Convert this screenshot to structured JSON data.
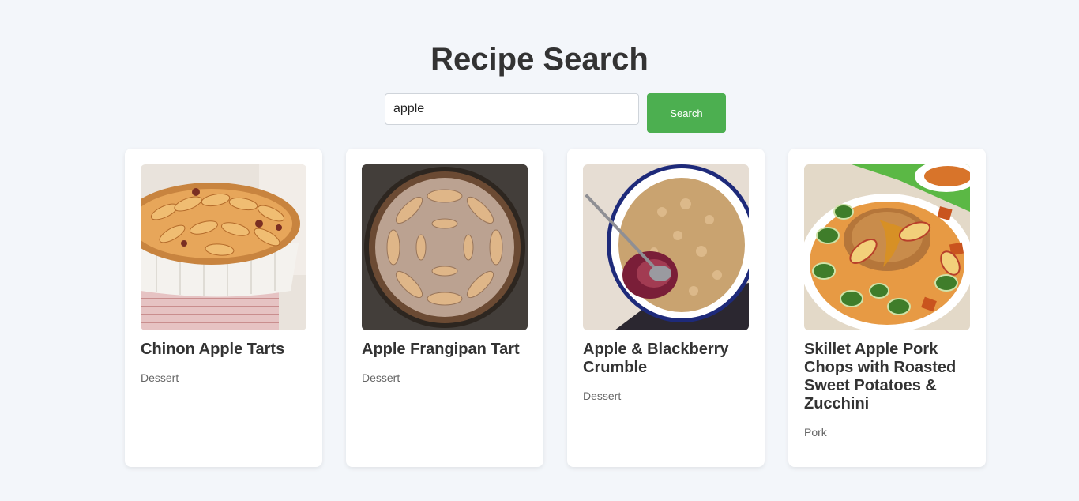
{
  "header": {
    "title": "Recipe Search"
  },
  "search": {
    "value": "apple",
    "button_label": "Search"
  },
  "recipes": [
    {
      "title": "Chinon Apple Tarts",
      "category": "Dessert",
      "image": "apple-tart-photo"
    },
    {
      "title": "Apple Frangipan Tart",
      "category": "Dessert",
      "image": "frangipane-tart-photo"
    },
    {
      "title": "Apple & Blackberry Crumble",
      "category": "Dessert",
      "image": "crumble-photo"
    },
    {
      "title": "Skillet Apple Pork Chops with Roasted Sweet Potatoes & Zucchini",
      "category": "Pork",
      "image": "pork-chops-photo"
    }
  ]
}
